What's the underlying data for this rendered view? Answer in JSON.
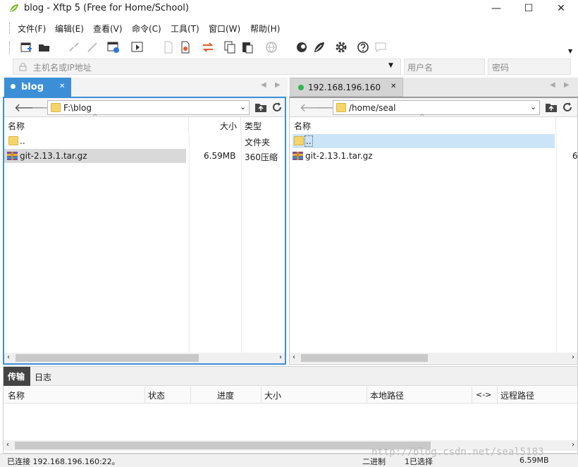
{
  "window": {
    "title": "blog - Xftp 5 (Free for Home/School)",
    "minimize": "—",
    "maximize": "☐",
    "close": "✕"
  },
  "menu": [
    "文件(F)",
    "编辑(E)",
    "查看(V)",
    "命令(C)",
    "工具(T)",
    "窗口(W)",
    "帮助(H)"
  ],
  "toolbar": {
    "icons": [
      "new-session-icon",
      "open-folder-icon",
      "disconnect-icon",
      "reconnect-icon",
      "session-properties-icon",
      "run-icon",
      "new-file-icon",
      "new-file-red-icon",
      "transfer-icon",
      "copy-icon",
      "paste-icon",
      "globe-icon",
      "xshell-icon",
      "xftp-icon",
      "settings-icon",
      "help-icon",
      "chat-icon"
    ]
  },
  "connect": {
    "host_placeholder": "主机名或IP地址",
    "user_placeholder": "用户名",
    "pass_placeholder": "密码"
  },
  "left": {
    "tab": "blog",
    "path": "F:\\blog",
    "columns": {
      "name": "名称",
      "size": "大小",
      "type": "类型"
    },
    "rows": [
      {
        "name": "..",
        "size": "",
        "type": "文件夹",
        "icon": "folder-icon"
      },
      {
        "name": "git-2.13.1.tar.gz",
        "size": "6.59MB",
        "type": "360压缩",
        "icon": "archive-icon"
      }
    ]
  },
  "right": {
    "tab": "192.168.196.160",
    "path": "/home/seal",
    "columns": {
      "name": "名称",
      "size_cut": "6"
    },
    "rows": [
      {
        "name": "..",
        "icon": "folder-icon"
      },
      {
        "name": "git-2.13.1.tar.gz",
        "icon": "archive-icon"
      }
    ]
  },
  "bottom": {
    "tabs": [
      "传输",
      "日志"
    ],
    "columns": [
      "名称",
      "状态",
      "进度",
      "大小",
      "本地路径",
      "<->",
      "远程路径"
    ]
  },
  "status": {
    "connection": "已连接 192.168.196.160:22。",
    "mode": "二进制",
    "selected": "1已选择",
    "size": "6.59MB",
    "watermark": "http://blog.csdn.net/seal5183"
  },
  "colors": {
    "accent": "#3c8fd6",
    "connected": "#2db84a",
    "folder": "#f5d56b",
    "selection": "#cce4f7"
  }
}
